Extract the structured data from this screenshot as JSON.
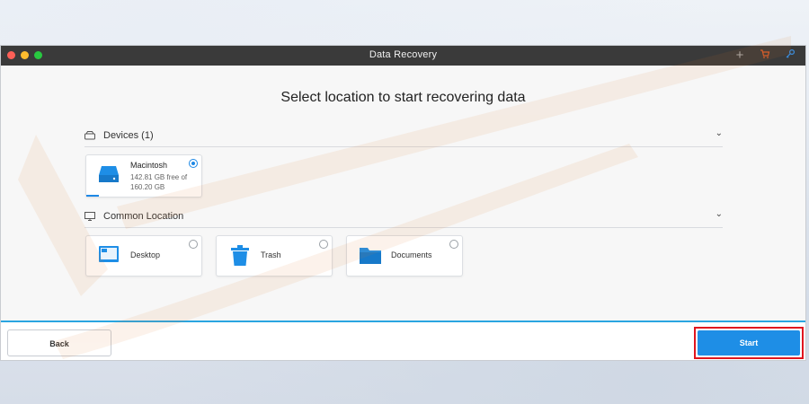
{
  "window": {
    "title": "Data Recovery",
    "toolbar_icons": [
      "plus-icon",
      "cart-icon",
      "key-icon"
    ]
  },
  "main": {
    "heading": "Select location to start recovering data",
    "devices": {
      "label": "Devices (1)",
      "items": [
        {
          "name": "Macintosh",
          "size": "142.81 GB free of 160.20 GB",
          "selected": true
        }
      ]
    },
    "common": {
      "label": "Common Location",
      "items": [
        {
          "name": "Desktop",
          "selected": false
        },
        {
          "name": "Trash",
          "selected": false
        },
        {
          "name": "Documents",
          "selected": false
        }
      ]
    }
  },
  "footer": {
    "back_label": "Back",
    "start_label": "Start"
  },
  "colors": {
    "accent": "#1e8ee6",
    "highlight": "#e0161f",
    "titlebar": "#3a3a3a"
  }
}
